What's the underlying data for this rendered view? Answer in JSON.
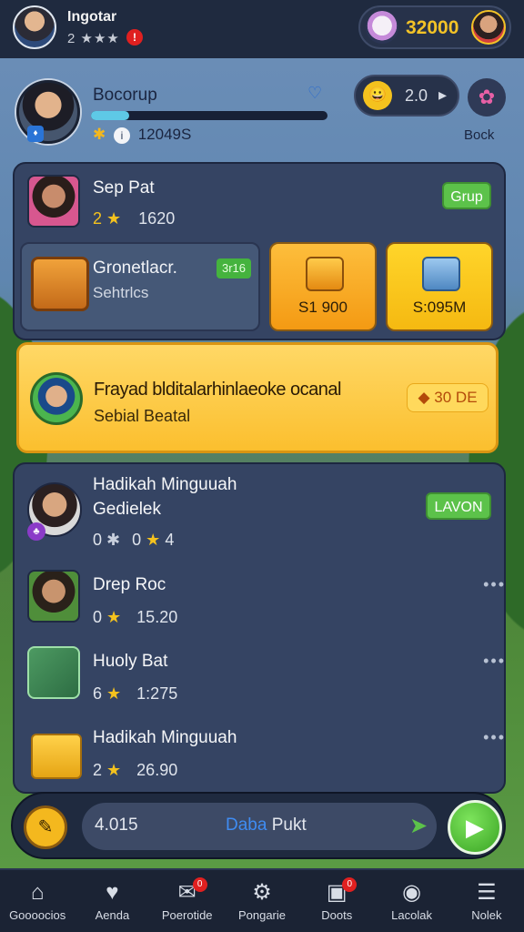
{
  "topbar": {
    "name": "Ingotar",
    "rating": "2 ★★★",
    "notif_badge": "!",
    "currency_value": "32000"
  },
  "profile": {
    "group_name": "Bocorup",
    "stats_value": "12049S",
    "level_value": "2.0",
    "level_icon": "😀",
    "settings_label": "Bock",
    "xp_progress": 0.16
  },
  "card_a": {
    "item_title": "Sep Pat",
    "item_stats": "1620",
    "grup_label": "Grup",
    "sub_title": "Gronetlacr.",
    "sub_badge": "3r16",
    "sub_desc": "Sehtrlcs",
    "offers": [
      {
        "price": "S1 900"
      },
      {
        "price": "S:095M"
      }
    ]
  },
  "event": {
    "title": "Frayad blditalarhinlaeoke ocanal",
    "subtitle": "Sebial Beatal",
    "price": "30 DE"
  },
  "list": {
    "items": [
      {
        "title": "Hadikah Minguuah",
        "subtitle": "Gedielek",
        "stat_left": "0",
        "stat_right": "0",
        "stat_num": "4",
        "action": "LAVON"
      },
      {
        "title": "Drep Roc",
        "stat_left": "0",
        "stat_value": "15.20"
      },
      {
        "title": "Huoly Bat",
        "stat_left": "6",
        "stat_value": "1:275"
      },
      {
        "title": "Hadikah Minguuah",
        "stat_left": "2",
        "stat_value": "26.90"
      }
    ]
  },
  "action_bar": {
    "left_value": "4.015",
    "center_blue": "Daba",
    "center_rest": "Pukt"
  },
  "nav": [
    {
      "label": "Goooocios",
      "icon": "home-icon"
    },
    {
      "label": "Aenda",
      "icon": "heart-icon"
    },
    {
      "label": "Poerotide",
      "icon": "mail-icon",
      "badge": "0"
    },
    {
      "label": "Pongarie",
      "icon": "gear-icon"
    },
    {
      "label": "Doots",
      "icon": "bag-icon",
      "badge": "0"
    },
    {
      "label": "Lacolak",
      "icon": "globe-icon"
    },
    {
      "label": "Nolek",
      "icon": "menu-icon"
    }
  ],
  "colors": {
    "accent_green": "#5cc24a",
    "gold": "#f4c21e",
    "panel": "#354463",
    "navbar": "#1b2334"
  }
}
